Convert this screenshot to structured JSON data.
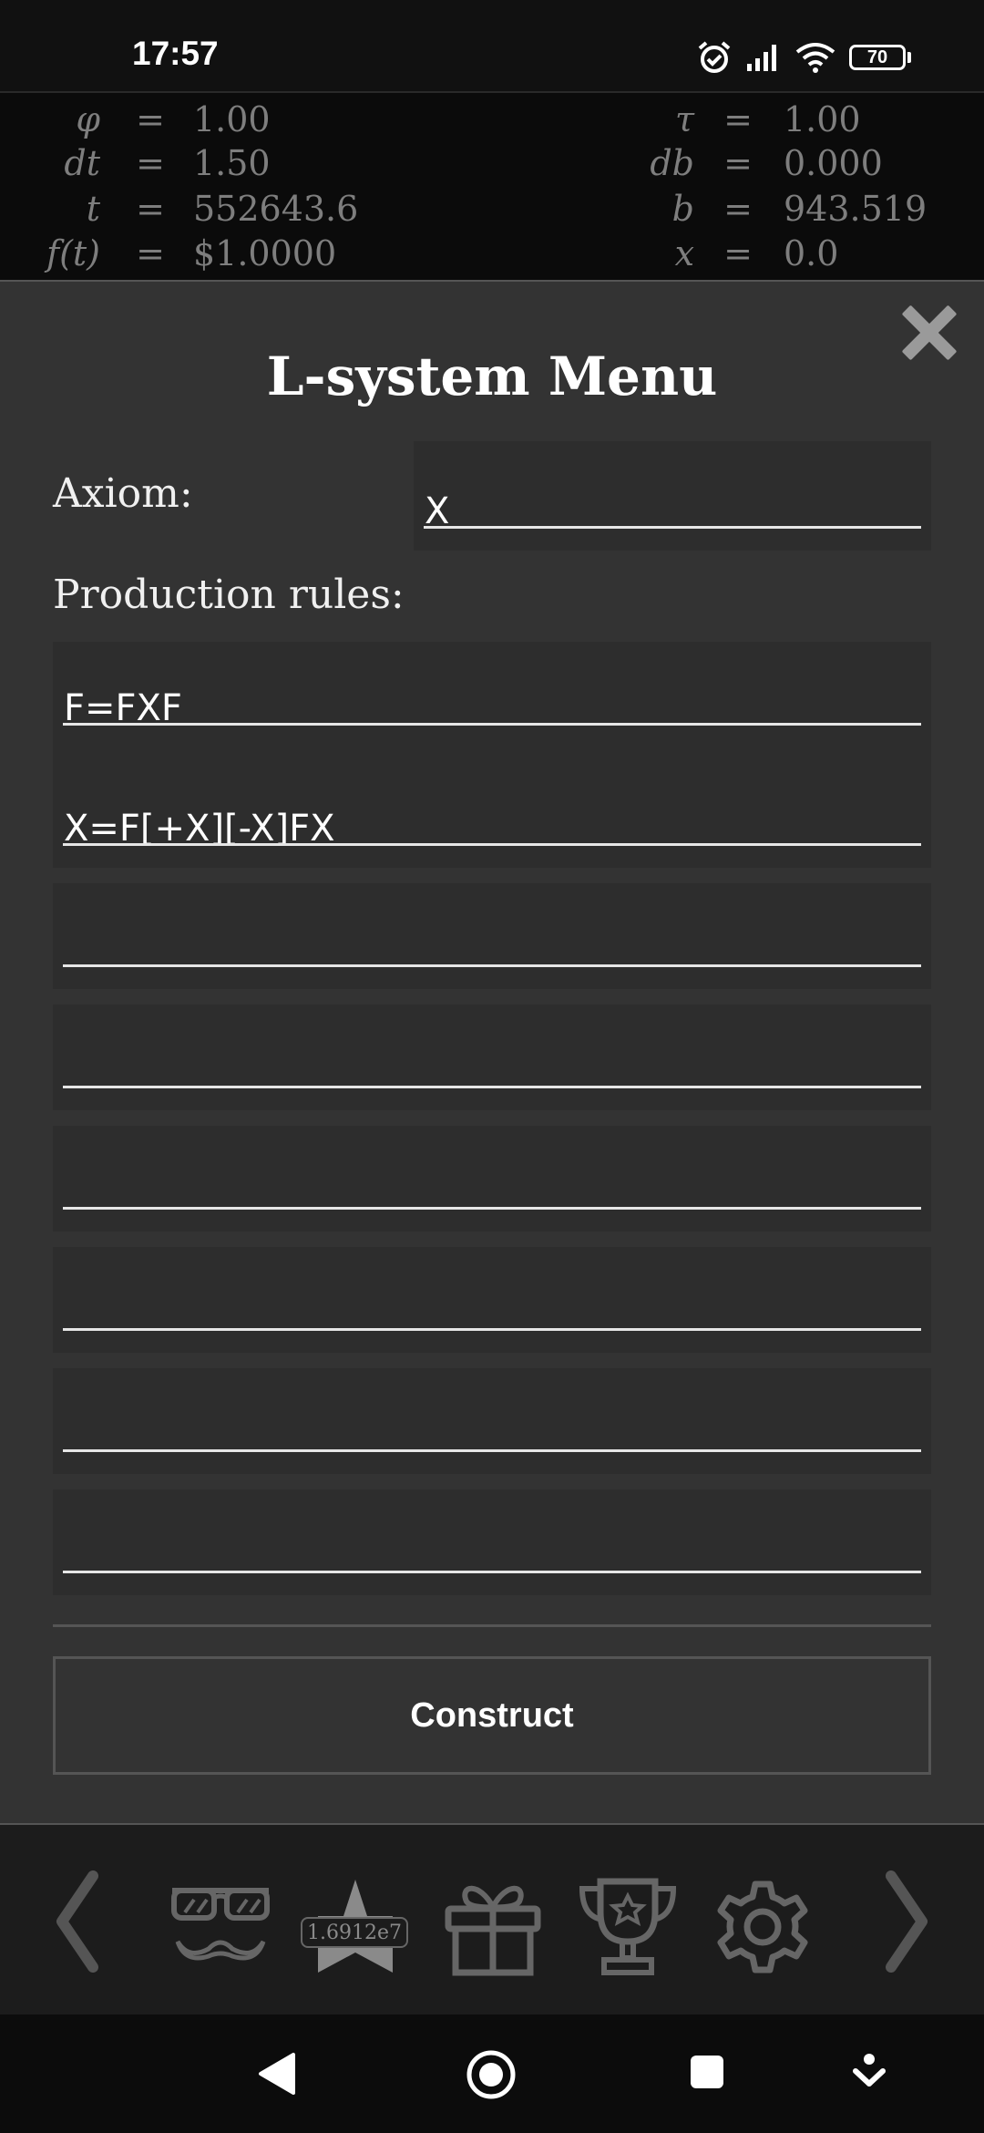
{
  "status": {
    "time": "17:57",
    "battery": "70"
  },
  "params": {
    "left": [
      {
        "name": "φ",
        "eq": "=",
        "value": "1.00"
      },
      {
        "name": "dt",
        "eq": "=",
        "value": "1.50"
      },
      {
        "name": "t",
        "eq": "=",
        "value": "552643.6"
      },
      {
        "name": "f(t)",
        "eq": "=",
        "value": "$1.0000"
      }
    ],
    "right": [
      {
        "name": "τ",
        "eq": "=",
        "value": "1.00"
      },
      {
        "name": "db",
        "eq": "=",
        "value": "0.000"
      },
      {
        "name": "b",
        "eq": "=",
        "value": "943.519"
      },
      {
        "name": "x",
        "eq": "=",
        "value": "0.0"
      }
    ]
  },
  "menu": {
    "title": "L-system Menu",
    "axiom_label": "Axiom:",
    "axiom_value": "X",
    "rules_label": "Production rules:",
    "rules": [
      "F=FXF",
      "X=F[+X][-X]FX",
      "",
      "",
      "",
      "",
      "",
      ""
    ],
    "construct_label": "Construct"
  },
  "toolbar": {
    "star_count": "1.6912e7",
    "icons": [
      "chevron-left-icon",
      "disguise-icon",
      "star-icon",
      "gift-icon",
      "trophy-icon",
      "gear-icon",
      "chevron-right-icon"
    ]
  },
  "colors": {
    "menu_bg": "#333333",
    "field_bg": "#2d2d2d",
    "muted_text": "#7e7e7e"
  }
}
